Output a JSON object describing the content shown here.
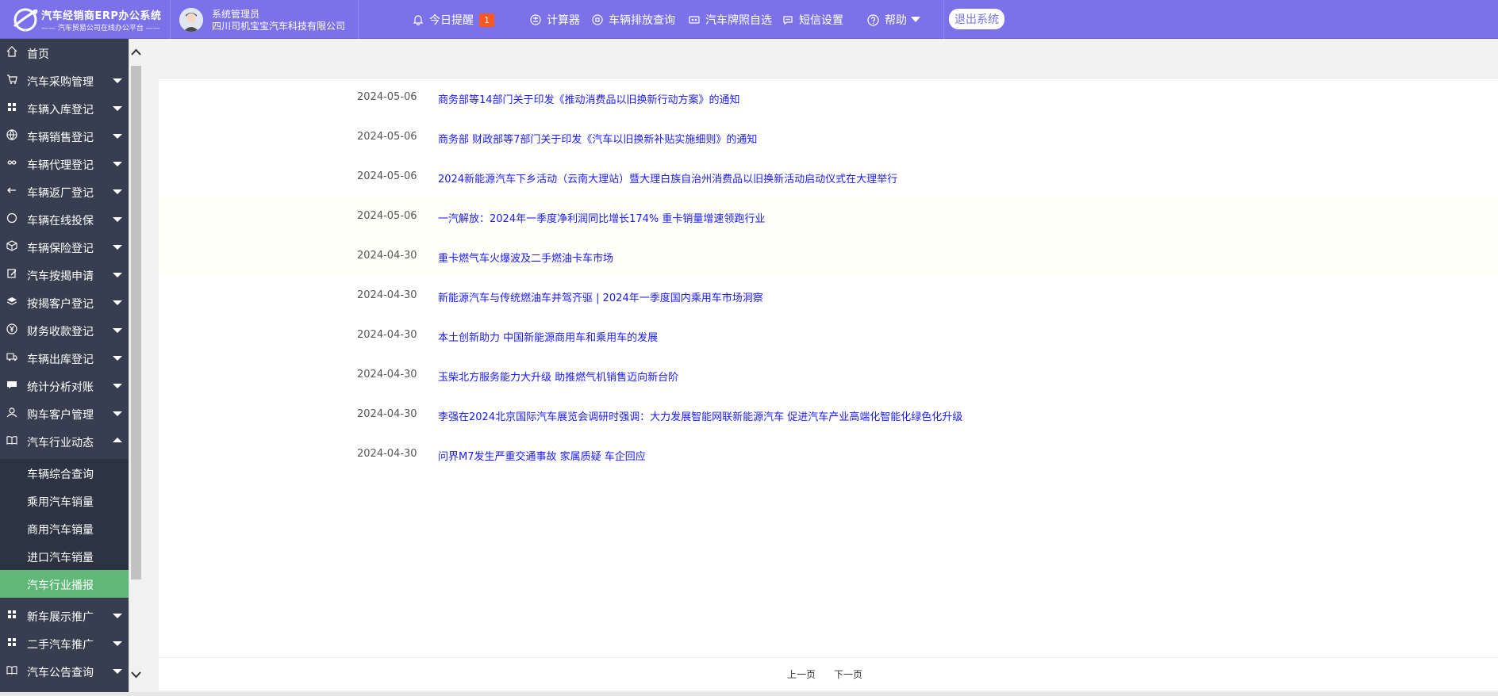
{
  "header": {
    "logo_title": "汽车经销商ERP办公系统",
    "logo_subtitle": "—— 汽车贸易公司在线办公平台 ——",
    "user_role": "系统管理员",
    "company": "四川司机宝宝汽车科技有限公司",
    "reminder_label": "今日提醒",
    "reminder_count": "1",
    "calculator_label": "计算器",
    "emission_label": "车辆排放查询",
    "plate_label": "汽车牌照自选",
    "sms_label": "短信设置",
    "help_label": "帮助",
    "logout_label": "退出系统",
    "accent_color": "#7b72ea"
  },
  "sidebar": {
    "items": [
      {
        "label": "首页",
        "icon": "home-icon"
      },
      {
        "label": "汽车采购管理",
        "icon": "cart-icon"
      },
      {
        "label": "车辆入库登记",
        "icon": "grid-icon"
      },
      {
        "label": "车辆销售登记",
        "icon": "globe-icon"
      },
      {
        "label": "车辆代理登记",
        "icon": "infinity-icon"
      },
      {
        "label": "车辆返厂登记",
        "icon": "return-icon"
      },
      {
        "label": "车辆在线投保",
        "icon": "circle-icon"
      },
      {
        "label": "车辆保险登记",
        "icon": "box-icon"
      },
      {
        "label": "汽车按揭申请",
        "icon": "edit-icon"
      },
      {
        "label": "按揭客户登记",
        "icon": "layers-icon"
      },
      {
        "label": "财务收款登记",
        "icon": "yen-icon"
      },
      {
        "label": "车辆出库登记",
        "icon": "truck-icon"
      },
      {
        "label": "统计分析对账",
        "icon": "chat-icon"
      },
      {
        "label": "购车客户管理",
        "icon": "user-icon"
      },
      {
        "label": "汽车行业动态",
        "icon": "read-icon"
      }
    ],
    "sub_items": [
      {
        "label": "车辆综合查询"
      },
      {
        "label": "乘用汽车销量"
      },
      {
        "label": "商用汽车销量"
      },
      {
        "label": "进口汽车销量"
      },
      {
        "label": "汽车行业播报"
      }
    ],
    "after_items": [
      {
        "label": "新车展示推广",
        "icon": "grid-icon"
      },
      {
        "label": "二手汽车推广",
        "icon": "grid-icon"
      },
      {
        "label": "汽车公告查询",
        "icon": "read-icon"
      }
    ],
    "active_color": "#5fb878"
  },
  "news": [
    {
      "date": "2024-05-06",
      "title": "商务部等14部门关于印发《推动消费品以旧换新行动方案》的通知"
    },
    {
      "date": "2024-05-06",
      "title": "商务部 财政部等7部门关于印发《汽车以旧换新补贴实施细则》的通知"
    },
    {
      "date": "2024-05-06",
      "title": "2024新能源汽车下乡活动（云南大理站）暨大理白族自治州消费品以旧换新活动启动仪式在大理举行"
    },
    {
      "date": "2024-05-06",
      "title": "一汽解放：2024年一季度净利润同比增长174% 重卡销量增速领跑行业"
    },
    {
      "date": "2024-04-30",
      "title": "重卡燃气车火爆波及二手燃油卡车市场"
    },
    {
      "date": "2024-04-30",
      "title": "新能源汽车与传统燃油车并驾齐驱 | 2024年一季度国内乘用车市场洞察"
    },
    {
      "date": "2024-04-30",
      "title": "本土创新助力 中国新能源商用车和乘用车的发展"
    },
    {
      "date": "2024-04-30",
      "title": "玉柴北方服务能力大升级 助推燃气机销售迈向新台阶"
    },
    {
      "date": "2024-04-30",
      "title": "李强在2024北京国际汽车展览会调研时强调：大力发展智能网联新能源汽车 促进汽车产业高端化智能化绿色化升级"
    },
    {
      "date": "2024-04-30",
      "title": "问界M7发生严重交通事故 家属质疑 车企回应"
    }
  ],
  "pager": {
    "prev_label": "上一页",
    "next_label": "下一页"
  }
}
